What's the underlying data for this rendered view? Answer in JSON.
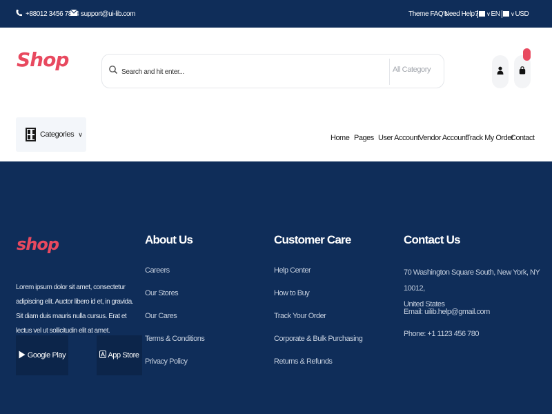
{
  "topbar": {
    "phone": "+88012 3456 7894",
    "email": "support@ui-lib.com",
    "faq": "Theme FAQ's",
    "help": "Need Help?",
    "language": "EN",
    "currency": "USD",
    "icons": [
      "phone-icon",
      "mail-icon",
      "flag-icon",
      "flag-icon"
    ]
  },
  "header": {
    "logo": "Shop",
    "search_placeholder": "Search and hit enter...",
    "category_select": "All Category",
    "icons": [
      "search-icon",
      "user-icon",
      "shopping-bag-icon"
    ]
  },
  "nav": {
    "categories_label": "Categories",
    "links": [
      "Home",
      "Pages",
      "User Account",
      "Vendor Account",
      "Track My Order",
      "Contact"
    ]
  },
  "footer": {
    "logo": "shop",
    "about_text": "Lorem ipsum dolor sit amet, consectetur adipiscing elit. Auctor libero id et, in gravida. Sit diam duis mauris nulla cursus. Erat et lectus vel ut sollicitudin elit at amet.",
    "google_play": "Google Play",
    "app_store": "App Store",
    "about": {
      "heading": "About Us",
      "links": [
        "Careers",
        "Our Stores",
        "Our Cares",
        "Terms & Conditions",
        "Privacy Policy"
      ]
    },
    "care": {
      "heading": "Customer Care",
      "links": [
        "Help Center",
        "How to Buy",
        "Track Your Order",
        "Corporate & Bulk Purchasing",
        "Returns & Refunds"
      ]
    },
    "contact": {
      "heading": "Contact Us",
      "address_line1": "70 Washington Square South, New York, NY 10012,",
      "address_line2": "United States",
      "email": "Email: uilib.help@gmail.com",
      "phone": "Phone: +1 1123 456 780"
    }
  },
  "colors": {
    "navy": "#0f2d59",
    "brand_pink": "#e8495f",
    "white": "#ffffff"
  }
}
